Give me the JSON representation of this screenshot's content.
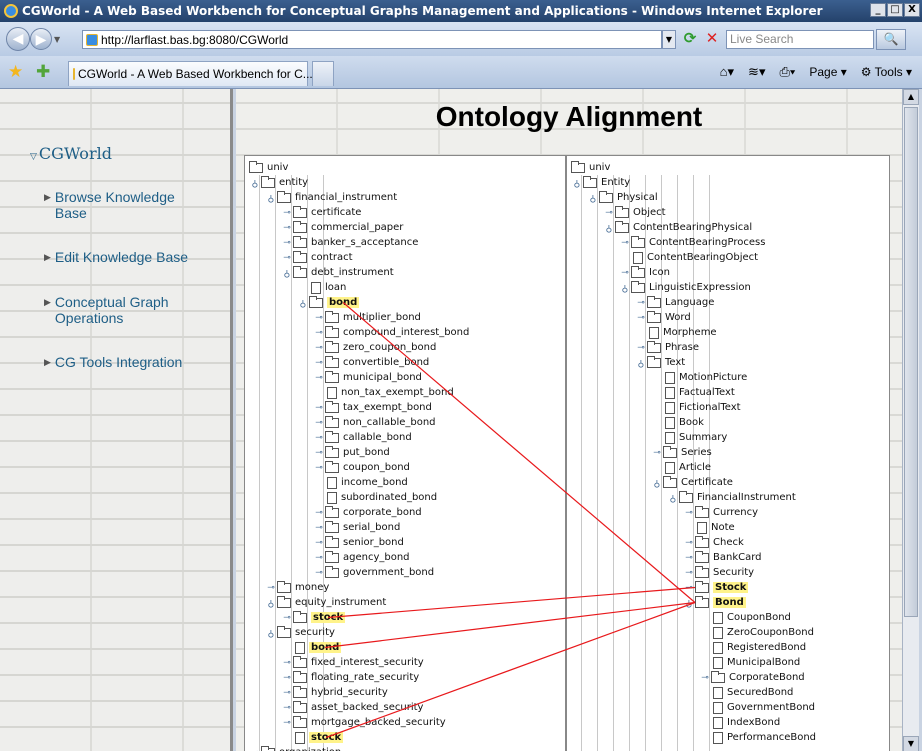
{
  "window": {
    "title": "CGWorld - A Web Based Workbench for Conceptual Graphs Management and Applications - Windows Internet Explorer",
    "controls": [
      "_",
      "□",
      "X"
    ]
  },
  "address": {
    "url": "http://larflast.bas.bg:8080/CGWorld",
    "search_placeholder": "Live Search"
  },
  "tab": {
    "label": "CGWorld - A Web Based Workbench for C..."
  },
  "toolbar": {
    "page_label": "Page",
    "tools_label": "Tools"
  },
  "sidebar": {
    "root": "CGWorld",
    "items": [
      {
        "label": "Browse Knowledge Base"
      },
      {
        "label": "Edit Knowledge Base"
      },
      {
        "label": "Conceptual Graph Operations"
      },
      {
        "label": "CG Tools Integration"
      }
    ]
  },
  "main": {
    "title": "Ontology Alignment"
  },
  "left_tree": [
    {
      "label": "univ",
      "depth": 0,
      "type": "folder",
      "handle": ""
    },
    {
      "label": "entity",
      "depth": 1,
      "type": "folder",
      "handle": "open"
    },
    {
      "label": "financial_instrument",
      "depth": 2,
      "type": "folder",
      "handle": "open"
    },
    {
      "label": "certificate",
      "depth": 3,
      "type": "folder",
      "handle": "closed"
    },
    {
      "label": "commercial_paper",
      "depth": 3,
      "type": "folder",
      "handle": "closed"
    },
    {
      "label": "banker_s_acceptance",
      "depth": 3,
      "type": "folder",
      "handle": "closed"
    },
    {
      "label": "contract",
      "depth": 3,
      "type": "folder",
      "handle": "closed"
    },
    {
      "label": "debt_instrument",
      "depth": 3,
      "type": "folder",
      "handle": "open"
    },
    {
      "label": "loan",
      "depth": 4,
      "type": "leaf",
      "handle": ""
    },
    {
      "label": "bond",
      "depth": 4,
      "type": "folder",
      "handle": "open",
      "highlight": true
    },
    {
      "label": "multiplier_bond",
      "depth": 5,
      "type": "folder",
      "handle": "closed"
    },
    {
      "label": "compound_interest_bond",
      "depth": 5,
      "type": "folder",
      "handle": "closed"
    },
    {
      "label": "zero_coupon_bond",
      "depth": 5,
      "type": "folder",
      "handle": "closed"
    },
    {
      "label": "convertible_bond",
      "depth": 5,
      "type": "folder",
      "handle": "closed"
    },
    {
      "label": "municipal_bond",
      "depth": 5,
      "type": "folder",
      "handle": "closed"
    },
    {
      "label": "non_tax_exempt_bond",
      "depth": 5,
      "type": "leaf",
      "handle": ""
    },
    {
      "label": "tax_exempt_bond",
      "depth": 5,
      "type": "folder",
      "handle": "closed"
    },
    {
      "label": "non_callable_bond",
      "depth": 5,
      "type": "folder",
      "handle": "closed"
    },
    {
      "label": "callable_bond",
      "depth": 5,
      "type": "folder",
      "handle": "closed"
    },
    {
      "label": "put_bond",
      "depth": 5,
      "type": "folder",
      "handle": "closed"
    },
    {
      "label": "coupon_bond",
      "depth": 5,
      "type": "folder",
      "handle": "closed"
    },
    {
      "label": "income_bond",
      "depth": 5,
      "type": "leaf",
      "handle": ""
    },
    {
      "label": "subordinated_bond",
      "depth": 5,
      "type": "leaf",
      "handle": ""
    },
    {
      "label": "corporate_bond",
      "depth": 5,
      "type": "folder",
      "handle": "closed"
    },
    {
      "label": "serial_bond",
      "depth": 5,
      "type": "folder",
      "handle": "closed"
    },
    {
      "label": "senior_bond",
      "depth": 5,
      "type": "folder",
      "handle": "closed"
    },
    {
      "label": "agency_bond",
      "depth": 5,
      "type": "folder",
      "handle": "closed"
    },
    {
      "label": "government_bond",
      "depth": 5,
      "type": "folder",
      "handle": "closed"
    },
    {
      "label": "money",
      "depth": 2,
      "type": "folder",
      "handle": "closed"
    },
    {
      "label": "equity_instrument",
      "depth": 2,
      "type": "folder",
      "handle": "open"
    },
    {
      "label": "stock",
      "depth": 3,
      "type": "folder",
      "handle": "closed",
      "highlight": true
    },
    {
      "label": "security",
      "depth": 2,
      "type": "folder",
      "handle": "open"
    },
    {
      "label": "bond",
      "depth": 3,
      "type": "leaf",
      "handle": "",
      "highlight": true
    },
    {
      "label": "fixed_interest_security",
      "depth": 3,
      "type": "folder",
      "handle": "closed"
    },
    {
      "label": "floating_rate_security",
      "depth": 3,
      "type": "folder",
      "handle": "closed"
    },
    {
      "label": "hybrid_security",
      "depth": 3,
      "type": "folder",
      "handle": "closed"
    },
    {
      "label": "asset_backed_security",
      "depth": 3,
      "type": "folder",
      "handle": "closed"
    },
    {
      "label": "mortgage_backed_security",
      "depth": 3,
      "type": "folder",
      "handle": "closed"
    },
    {
      "label": "stock",
      "depth": 3,
      "type": "leaf",
      "handle": "",
      "highlight": true
    },
    {
      "label": "organization",
      "depth": 1,
      "type": "folder",
      "handle": "closed"
    }
  ],
  "right_tree": [
    {
      "label": "univ",
      "depth": 0,
      "type": "folder",
      "handle": ""
    },
    {
      "label": "Entity",
      "depth": 1,
      "type": "folder",
      "handle": "open"
    },
    {
      "label": "Physical",
      "depth": 2,
      "type": "folder",
      "handle": "open"
    },
    {
      "label": "Object",
      "depth": 3,
      "type": "folder",
      "handle": "closed"
    },
    {
      "label": "ContentBearingPhysical",
      "depth": 3,
      "type": "folder",
      "handle": "open"
    },
    {
      "label": "ContentBearingProcess",
      "depth": 4,
      "type": "folder",
      "handle": "closed"
    },
    {
      "label": "ContentBearingObject",
      "depth": 4,
      "type": "leaf",
      "handle": ""
    },
    {
      "label": "Icon",
      "depth": 4,
      "type": "folder",
      "handle": "closed"
    },
    {
      "label": "LinguisticExpression",
      "depth": 4,
      "type": "folder",
      "handle": "open"
    },
    {
      "label": "Language",
      "depth": 5,
      "type": "folder",
      "handle": "closed"
    },
    {
      "label": "Word",
      "depth": 5,
      "type": "folder",
      "handle": "closed"
    },
    {
      "label": "Morpheme",
      "depth": 5,
      "type": "leaf",
      "handle": ""
    },
    {
      "label": "Phrase",
      "depth": 5,
      "type": "folder",
      "handle": "closed"
    },
    {
      "label": "Text",
      "depth": 5,
      "type": "folder",
      "handle": "open"
    },
    {
      "label": "MotionPicture",
      "depth": 6,
      "type": "leaf",
      "handle": ""
    },
    {
      "label": "FactualText",
      "depth": 6,
      "type": "leaf",
      "handle": ""
    },
    {
      "label": "FictionalText",
      "depth": 6,
      "type": "leaf",
      "handle": ""
    },
    {
      "label": "Book",
      "depth": 6,
      "type": "leaf",
      "handle": ""
    },
    {
      "label": "Summary",
      "depth": 6,
      "type": "leaf",
      "handle": ""
    },
    {
      "label": "Series",
      "depth": 6,
      "type": "folder",
      "handle": "closed"
    },
    {
      "label": "Article",
      "depth": 6,
      "type": "leaf",
      "handle": ""
    },
    {
      "label": "Certificate",
      "depth": 6,
      "type": "folder",
      "handle": "open"
    },
    {
      "label": "FinancialInstrument",
      "depth": 7,
      "type": "folder",
      "handle": "open"
    },
    {
      "label": "Currency",
      "depth": 8,
      "type": "folder",
      "handle": "closed"
    },
    {
      "label": "Note",
      "depth": 8,
      "type": "leaf",
      "handle": ""
    },
    {
      "label": "Check",
      "depth": 8,
      "type": "folder",
      "handle": "closed"
    },
    {
      "label": "BankCard",
      "depth": 8,
      "type": "folder",
      "handle": "closed"
    },
    {
      "label": "Security",
      "depth": 8,
      "type": "folder",
      "handle": "closed"
    },
    {
      "label": "Stock",
      "depth": 8,
      "type": "folder",
      "handle": "closed",
      "highlight": true
    },
    {
      "label": "Bond",
      "depth": 8,
      "type": "folder",
      "handle": "open",
      "highlight": true
    },
    {
      "label": "CouponBond",
      "depth": 9,
      "type": "leaf",
      "handle": ""
    },
    {
      "label": "ZeroCouponBond",
      "depth": 9,
      "type": "leaf",
      "handle": ""
    },
    {
      "label": "RegisteredBond",
      "depth": 9,
      "type": "leaf",
      "handle": ""
    },
    {
      "label": "MunicipalBond",
      "depth": 9,
      "type": "leaf",
      "handle": ""
    },
    {
      "label": "CorporateBond",
      "depth": 9,
      "type": "folder",
      "handle": "closed"
    },
    {
      "label": "SecuredBond",
      "depth": 9,
      "type": "leaf",
      "handle": ""
    },
    {
      "label": "GovernmentBond",
      "depth": 9,
      "type": "leaf",
      "handle": ""
    },
    {
      "label": "IndexBond",
      "depth": 9,
      "type": "leaf",
      "handle": ""
    },
    {
      "label": "PerformanceBond",
      "depth": 9,
      "type": "leaf",
      "handle": ""
    }
  ],
  "alignments": [
    {
      "from": 9,
      "to": 29
    },
    {
      "from": 30,
      "to": 28
    },
    {
      "from": 32,
      "to": 29
    },
    {
      "from": 38,
      "to": 29
    }
  ],
  "colors": {
    "link": "#e8191c",
    "highlight": "#fff38a",
    "sidebar_link": "#1e5e86"
  }
}
